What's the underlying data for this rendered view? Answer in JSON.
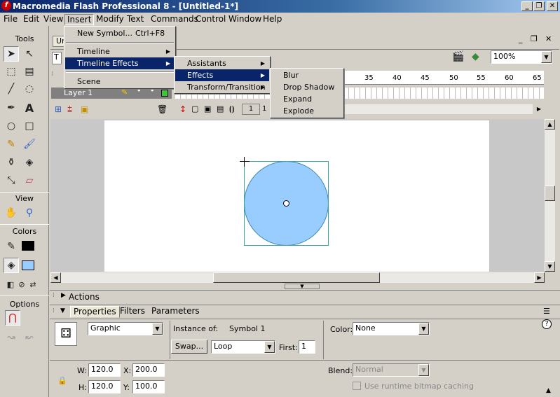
{
  "window": {
    "title": "Macromedia Flash Professional 8 - [Untitled-1*]",
    "app_icon": "f"
  },
  "window_controls": {
    "minimize": "_",
    "restore": "❐",
    "close": "✕"
  },
  "menubar": [
    "File",
    "Edit",
    "View",
    "Insert",
    "Modify",
    "Text",
    "Commands",
    "Control",
    "Window",
    "Help"
  ],
  "insert_menu": {
    "items": [
      {
        "label": "New Symbol...",
        "shortcut": "Ctrl+F8"
      },
      {
        "label": "Timeline"
      },
      {
        "label": "Timeline Effects"
      },
      {
        "label": "Scene"
      }
    ]
  },
  "timeline_effects_menu": [
    "Assistants",
    "Effects",
    "Transform/Transition"
  ],
  "effects_menu": [
    "Blur",
    "Drop Shadow",
    "Expand",
    "Explode"
  ],
  "tools": {
    "title": "Tools",
    "view_label": "View",
    "colors_label": "Colors",
    "options_label": "Options",
    "stroke_color": "#000000",
    "fill_color": "#99ccff"
  },
  "document": {
    "tab": "Ur",
    "scene_tab": "T",
    "zoom": "100%",
    "layer_name": "Layer 1",
    "frame_numbers": [
      "35",
      "40",
      "45",
      "50",
      "55",
      "60",
      "65"
    ],
    "current_frame": "1",
    "frame_field": "1"
  },
  "stage": {
    "shape_color": "#99ccff"
  },
  "actions_panel": {
    "title": "Actions"
  },
  "properties_panel": {
    "tabs": [
      "Properties",
      "Filters",
      "Parameters"
    ],
    "symbol_type": "Graphic",
    "instance_of_label": "Instance of:",
    "instance_of_value": "Symbol 1",
    "swap_button": "Swap...",
    "loop_value": "Loop",
    "first_label": "First:",
    "first_value": "1",
    "color_label": "Color:",
    "color_value": "None",
    "w_label": "W:",
    "w_value": "120.0",
    "h_label": "H:",
    "h_value": "120.0",
    "x_label": "X:",
    "x_value": "200.0",
    "y_label": "Y:",
    "y_value": "100.0",
    "blend_label": "Blend:",
    "blend_value": "Normal",
    "cache_label": "Use runtime bitmap caching"
  }
}
